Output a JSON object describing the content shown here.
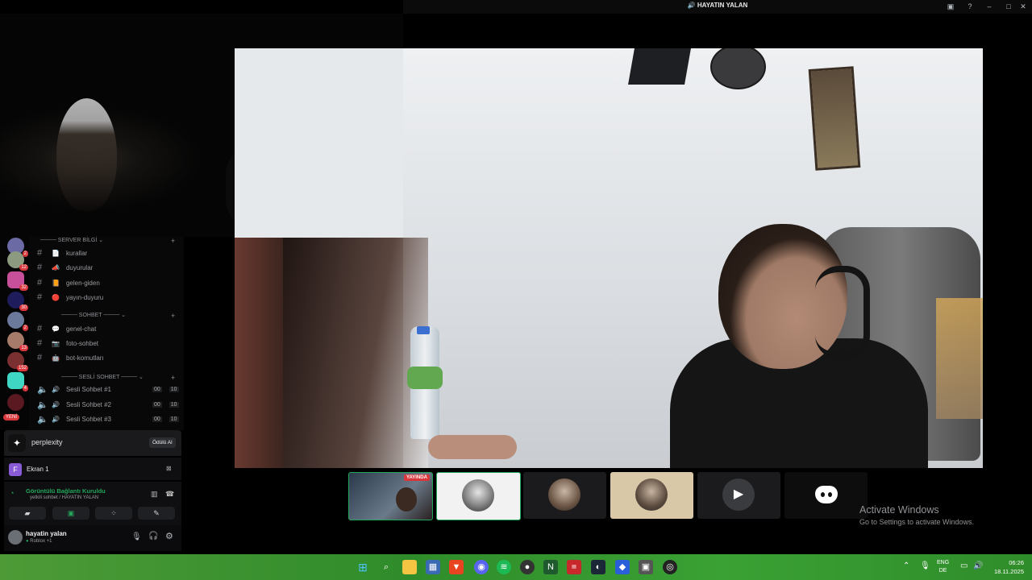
{
  "window": {
    "title": "HAYATIN YALAN"
  },
  "server_sidebar": {
    "guild_badges": [
      "2",
      "12",
      "32",
      "30",
      "2",
      "13",
      "152",
      "4",
      "YENİ"
    ]
  },
  "channels": {
    "categories": [
      {
        "label": "SERVER BİLGİ"
      },
      {
        "label": "SOHBET"
      },
      {
        "label": "SESLİ SOHBET"
      }
    ],
    "text_channels_info": [
      {
        "name": "kurallar",
        "emoji": "📄"
      },
      {
        "name": "duyurular",
        "emoji": "📣"
      },
      {
        "name": "gelen-giden",
        "emoji": "📙"
      },
      {
        "name": "yayın-duyuru",
        "emoji": "🔴"
      }
    ],
    "text_channels_chat": [
      {
        "name": "genel-chat",
        "emoji": "💬"
      },
      {
        "name": "foto-sohbet",
        "emoji": "📷"
      },
      {
        "name": "bot-komutları",
        "emoji": "🤖"
      }
    ],
    "voice_channels": [
      {
        "name": "Sesli Sohbet #1",
        "count_a": "00",
        "count_b": "10"
      },
      {
        "name": "Sesli Sohbet #2",
        "count_a": "00",
        "count_b": "10"
      },
      {
        "name": "Sesli Sohbet #3",
        "count_a": "00",
        "count_b": "10"
      }
    ]
  },
  "promo": {
    "name": "perplexity",
    "button": "Ödülü Al"
  },
  "stream": {
    "label": "Ekran 1"
  },
  "voice_status": {
    "title": "Görüntülü Bağlantı Kuruldu",
    "subtitle": "yetkili sohbet / HAYATIN YALAN"
  },
  "user_panel": {
    "name": "hayatin yalan",
    "status": "Roblox +1"
  },
  "participants": [
    {
      "name": "streamer",
      "badge": "YAYINDA"
    },
    {
      "name": "helmet-avatar"
    },
    {
      "name": "woman-avatar-1"
    },
    {
      "name": "woman-avatar-2"
    },
    {
      "name": "camera-tile"
    },
    {
      "name": "discord-tile"
    }
  ],
  "watermark": {
    "title": "Activate Windows",
    "subtitle": "Go to Settings to activate Windows."
  },
  "taskbar": {
    "lang_top": "ENG",
    "lang_bottom": "DE",
    "time": "06:26",
    "date": "18.11.2025"
  },
  "colors": {
    "accent_green": "#23a55a",
    "live_red": "#da373c",
    "taskbar_green": "#3aa134"
  }
}
